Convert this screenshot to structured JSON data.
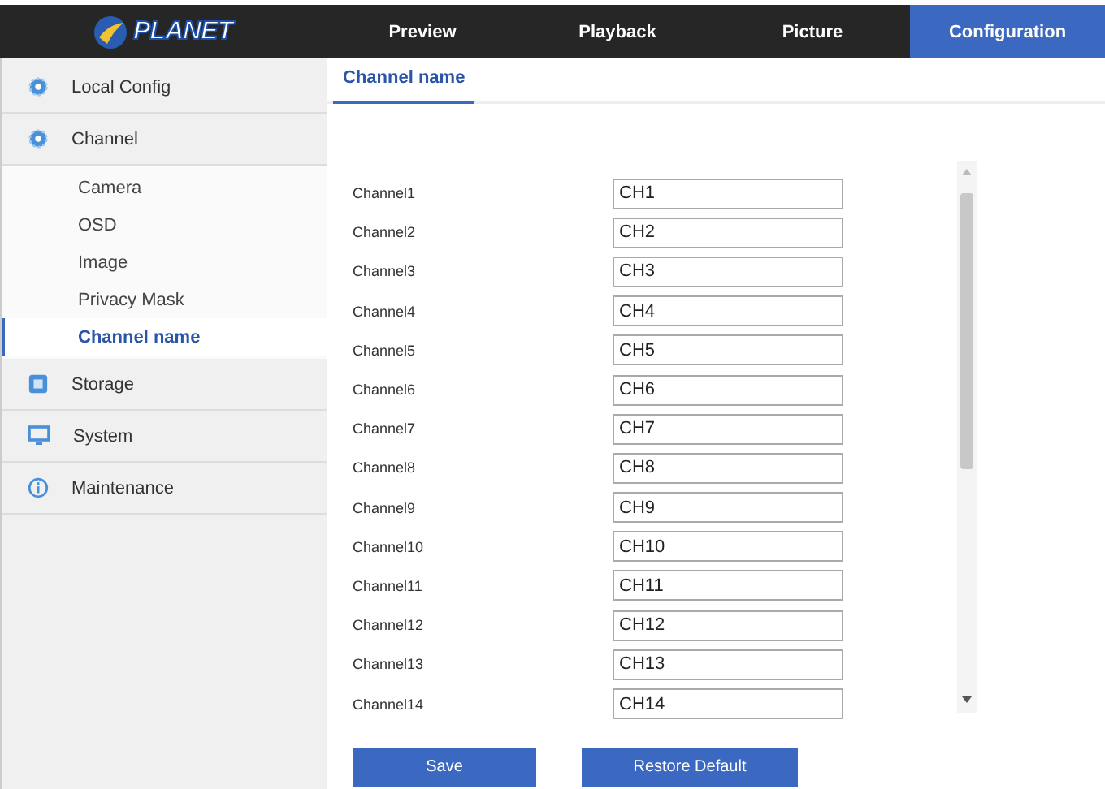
{
  "header": {
    "logo": "PLANET",
    "nav": [
      {
        "label": "Preview",
        "selected": false
      },
      {
        "label": "Playback",
        "selected": false
      },
      {
        "label": "Picture",
        "selected": false
      },
      {
        "label": "Configuration",
        "selected": true
      }
    ]
  },
  "sidebar": {
    "items": [
      {
        "label": "Local Config"
      },
      {
        "label": "Channel",
        "children": [
          {
            "label": "Camera",
            "selected": false
          },
          {
            "label": "OSD",
            "selected": false
          },
          {
            "label": "Image",
            "selected": false
          },
          {
            "label": "Privacy Mask",
            "selected": false
          },
          {
            "label": "Channel name",
            "selected": true
          }
        ]
      },
      {
        "label": "Storage"
      },
      {
        "label": "System"
      },
      {
        "label": "Maintenance"
      }
    ]
  },
  "tabs": [
    {
      "label": "Channel name",
      "selected": true
    }
  ],
  "channels": [
    {
      "label": "Channel1",
      "value": "CH1"
    },
    {
      "label": "Channel2",
      "value": "CH2"
    },
    {
      "label": "Channel3",
      "value": "CH3"
    },
    {
      "label": "Channel4",
      "value": "CH4"
    },
    {
      "label": "Channel5",
      "value": "CH5"
    },
    {
      "label": "Channel6",
      "value": "CH6"
    },
    {
      "label": "Channel7",
      "value": "CH7"
    },
    {
      "label": "Channel8",
      "value": "CH8"
    },
    {
      "label": "Channel9",
      "value": "CH9"
    },
    {
      "label": "Channel10",
      "value": "CH10"
    },
    {
      "label": "Channel11",
      "value": "CH11"
    },
    {
      "label": "Channel12",
      "value": "CH12"
    },
    {
      "label": "Channel13",
      "value": "CH13"
    },
    {
      "label": "Channel14",
      "value": "CH14"
    }
  ],
  "buttons": [
    "Save",
    "Restore Default"
  ]
}
